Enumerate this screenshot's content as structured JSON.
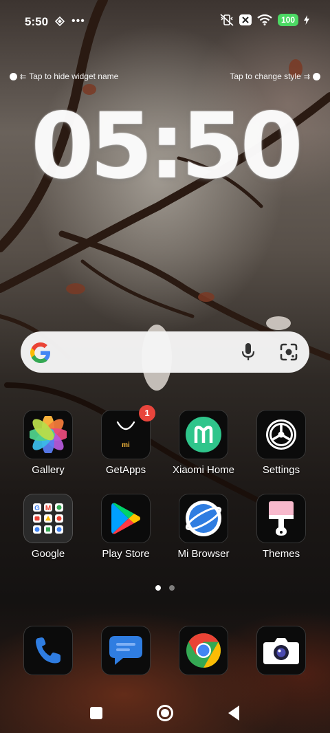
{
  "status": {
    "time": "5:50",
    "battery": "100",
    "icons": [
      "vibrate-off-icon",
      "sim-off-icon",
      "wifi-icon",
      "charging-icon"
    ],
    "battery_color": "#4cd964"
  },
  "widget": {
    "hint_left": "Tap to hide widget name",
    "hint_right": "Tap to change style",
    "clock": "05:50"
  },
  "search": {
    "icons": [
      "google-logo",
      "microphone-icon",
      "google-lens-icon"
    ]
  },
  "apps": [
    {
      "name": "gallery",
      "label": "Gallery"
    },
    {
      "name": "getapps",
      "label": "GetApps",
      "badge": "1"
    },
    {
      "name": "xiaomi-home",
      "label": "Xiaomi Home"
    },
    {
      "name": "settings",
      "label": "Settings"
    },
    {
      "name": "google-folder",
      "label": "Google"
    },
    {
      "name": "play-store",
      "label": "Play Store"
    },
    {
      "name": "mi-browser",
      "label": "Mi Browser"
    },
    {
      "name": "themes",
      "label": "Themes"
    }
  ],
  "dock": [
    {
      "name": "phone"
    },
    {
      "name": "messages"
    },
    {
      "name": "chrome"
    },
    {
      "name": "camera"
    }
  ],
  "pager": {
    "pages": 2,
    "active": 0
  },
  "navbar": {
    "buttons": [
      "recents-button",
      "home-button",
      "back-button"
    ]
  }
}
